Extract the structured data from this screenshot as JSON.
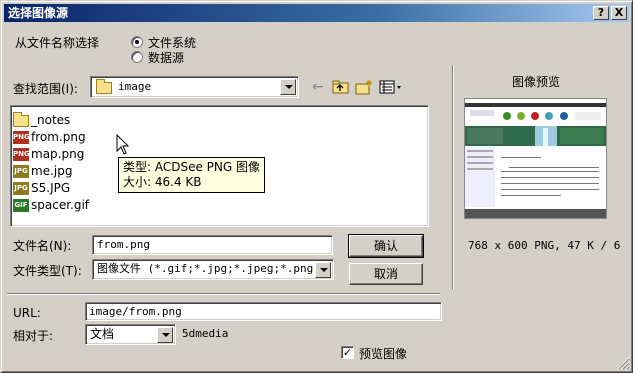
{
  "window": {
    "title": "选择图像源",
    "help_label": "?",
    "close_label": "X"
  },
  "source": {
    "label": "从文件名称选择",
    "options": [
      "文件系统",
      "数据源"
    ],
    "selected": "文件系统"
  },
  "lookin": {
    "label": "查找范围(I):",
    "value": "image",
    "icons": [
      "back-icon",
      "up-folder-icon",
      "new-folder-icon",
      "view-menu-icon"
    ]
  },
  "files": [
    {
      "name": "_notes",
      "type": "folder",
      "tag": ""
    },
    {
      "name": "from.png",
      "type": "png",
      "tag": "PNG",
      "color": "#b03020"
    },
    {
      "name": "map.png",
      "type": "png",
      "tag": "PNG",
      "color": "#b03020"
    },
    {
      "name": "me.jpg",
      "type": "jpg",
      "tag": "JPG",
      "color": "#8a7a20"
    },
    {
      "name": "S5.JPG",
      "type": "jpg",
      "tag": "JPG",
      "color": "#8a7a20"
    },
    {
      "name": "spacer.gif",
      "type": "gif",
      "tag": "GIF",
      "color": "#2a7a2a"
    }
  ],
  "tooltip": {
    "line1": "类型: ACDSee PNG 图像",
    "line2": "大小: 46.4 KB"
  },
  "filename": {
    "label": "文件名(N):",
    "value": "from.png"
  },
  "filetype": {
    "label": "文件类型(T):",
    "value": "图像文件 (*.gif;*.jpg;*.jpeg;*.png)"
  },
  "buttons": {
    "ok": "确认",
    "cancel": "取消"
  },
  "url": {
    "label": "URL:",
    "value": "image/from.png"
  },
  "relative": {
    "label": "相对于:",
    "value": "文档",
    "site": "5dmedia"
  },
  "preview": {
    "title": "图像预览",
    "info": "768 x 600 PNG, 47 K / 6",
    "checkbox_label": "预览图像",
    "checked": true
  }
}
